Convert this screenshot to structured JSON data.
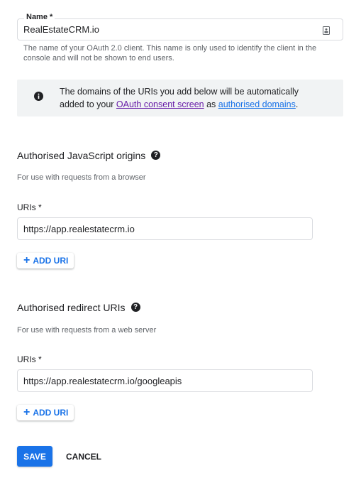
{
  "name_field": {
    "label": "Name *",
    "value": "RealEstateCRM.io",
    "hint": "The name of your OAuth 2.0 client. This name is only used to identify the client in the console and will not be shown to end users."
  },
  "info": {
    "text_before": "The domains of the URIs you add below will be automatically added to your ",
    "link1": "OAuth consent screen",
    "text_middle": " as ",
    "link2": "authorised domains",
    "text_after": "."
  },
  "js_origins": {
    "title": "Authorised JavaScript origins",
    "hint": "For use with requests from a browser",
    "uris_label": "URIs *",
    "uri_value": "https://app.realestatecrm.io",
    "add_label": "ADD URI"
  },
  "redirect": {
    "title": "Authorised redirect URIs",
    "hint": "For use with requests from a web server",
    "uris_label": "URIs *",
    "uri_value": "https://app.realestatecrm.io/googleapis",
    "add_label": "ADD URI"
  },
  "actions": {
    "save": "SAVE",
    "cancel": "CANCEL"
  },
  "colors": {
    "primary": "#1a73e8",
    "visited_link": "#681da8",
    "info_background": "#f1f3f4"
  }
}
